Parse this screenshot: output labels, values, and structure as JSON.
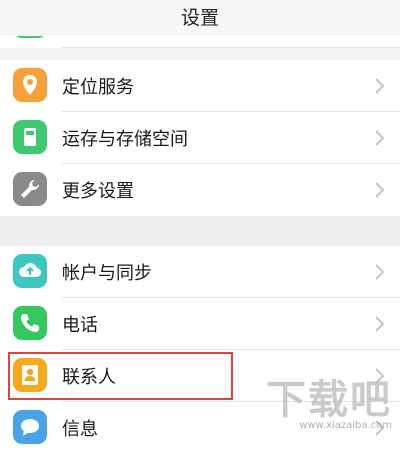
{
  "header": {
    "title": "设置"
  },
  "settings": {
    "partial_label": "",
    "items": [
      {
        "label": "定位服务",
        "icon": "location-pin-icon",
        "color": "#f7a13a"
      },
      {
        "label": "运存与存储空间",
        "icon": "storage-icon",
        "color": "#40c870"
      },
      {
        "label": "更多设置",
        "icon": "wrench-icon",
        "color": "#8a8a8a"
      },
      {
        "label": "帐户与同步",
        "icon": "cloud-sync-icon",
        "color": "#3ec6c0"
      },
      {
        "label": "电话",
        "icon": "phone-icon",
        "color": "#35c760"
      },
      {
        "label": "联系人",
        "icon": "contacts-icon",
        "color": "#f7a91e"
      },
      {
        "label": "信息",
        "icon": "message-icon",
        "color": "#4aa3e8"
      }
    ]
  },
  "watermark": {
    "logo": "下载吧",
    "url": "www.xiazaiba.com"
  },
  "colors": {
    "highlight": "#d94444",
    "chevron": "#c4c4c4"
  }
}
